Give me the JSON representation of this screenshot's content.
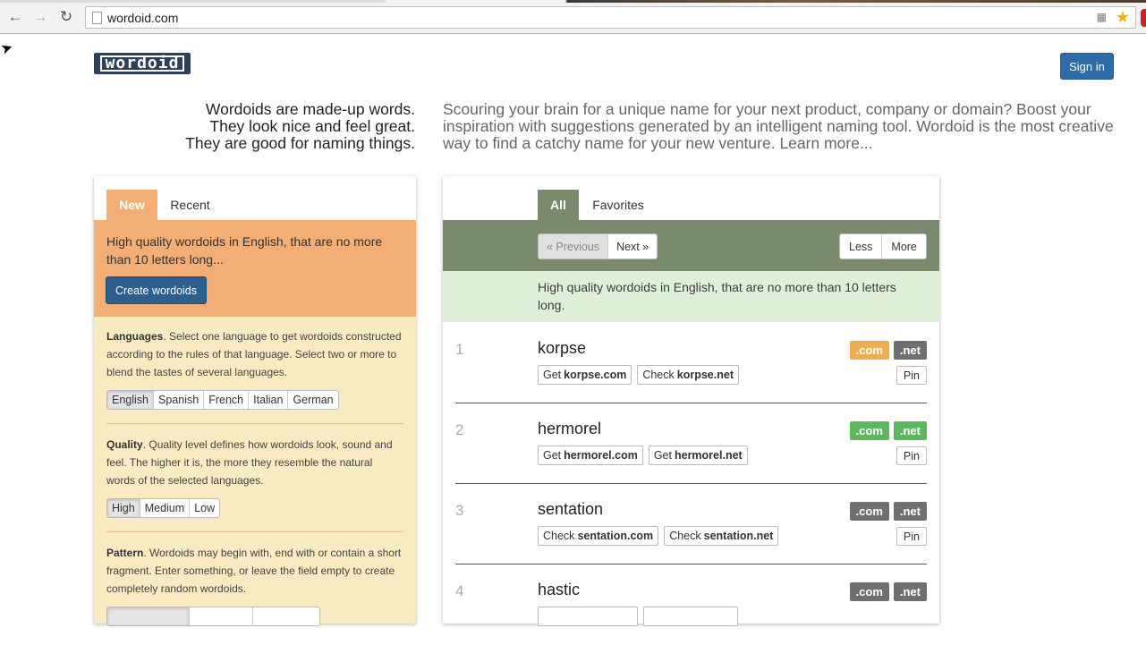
{
  "browser": {
    "url": "wordoid.com",
    "icons": [
      "back-icon",
      "forward-icon",
      "reload-icon",
      "page-icon",
      "translate-icon",
      "star-icon"
    ]
  },
  "header": {
    "logo_text": "wordoid",
    "signin_label": "Sign in"
  },
  "tagline": {
    "line1": "Wordoids are made-up words.",
    "line2": "They look nice and feel great.",
    "line3": "They are good for naming things."
  },
  "intro": {
    "text": "Scouring your brain for a unique name for your next product, company or domain? Boost your inspiration with suggestions generated by an intelligent naming tool. Wordoid is the most creative way to find a catchy name for your new venture.",
    "learn_more": "Learn more..."
  },
  "left": {
    "tabs": [
      {
        "label": "New",
        "active": true
      },
      {
        "label": "Recent",
        "active": false
      }
    ],
    "description": "High quality wordoids in English, that are no more than 10 letters long...",
    "create_label": "Create wordoids",
    "languages": {
      "title": "Languages",
      "text": ". Select one language to get wordoids constructed according to the rules of that language. Select two or more to blend the tastes of several languages.",
      "options": [
        {
          "label": "English",
          "active": true
        },
        {
          "label": "Spanish",
          "active": false
        },
        {
          "label": "French",
          "active": false
        },
        {
          "label": "Italian",
          "active": false
        },
        {
          "label": "German",
          "active": false
        }
      ]
    },
    "quality": {
      "title": "Quality",
      "text": ". Quality level defines how wordoids look, sound and feel. The higher it is, the more they resemble the natural words of the selected languages.",
      "options": [
        {
          "label": "High",
          "active": true
        },
        {
          "label": "Medium",
          "active": false
        },
        {
          "label": "Low",
          "active": false
        }
      ]
    },
    "pattern": {
      "title": "Pattern",
      "text": ". Wordoids may begin with, end with or contain a short fragment. Enter something, or leave the field empty to create completely random wordoids."
    }
  },
  "right": {
    "tabs": [
      {
        "label": "All",
        "active": true
      },
      {
        "label": "Favorites",
        "active": false
      }
    ],
    "pager": {
      "prev": "« Previous",
      "next": "Next »"
    },
    "size": {
      "less": "Less",
      "more": "More"
    },
    "info": "High quality wordoids in English, that are no more than 10 letters long.",
    "pin_label": "Pin",
    "results": [
      {
        "num": "1",
        "word": "korpse",
        "links": [
          {
            "prefix": "Get",
            "domain": "korpse.com"
          },
          {
            "prefix": "Check",
            "domain": "korpse.net"
          }
        ],
        "com": {
          "label": ".com",
          "status": "orange"
        },
        "net": {
          "label": ".net",
          "status": "gray"
        }
      },
      {
        "num": "2",
        "word": "hermorel",
        "links": [
          {
            "prefix": "Get",
            "domain": "hermorel.com"
          },
          {
            "prefix": "Get",
            "domain": "hermorel.net"
          }
        ],
        "com": {
          "label": ".com",
          "status": "green"
        },
        "net": {
          "label": ".net",
          "status": "green"
        }
      },
      {
        "num": "3",
        "word": "sentation",
        "links": [
          {
            "prefix": "Check",
            "domain": "sentation.com"
          },
          {
            "prefix": "Check",
            "domain": "sentation.net"
          }
        ],
        "com": {
          "label": ".com",
          "status": "gray"
        },
        "net": {
          "label": ".net",
          "status": "gray"
        }
      },
      {
        "num": "4",
        "word": "hastic",
        "links": [],
        "com": {
          "label": ".com",
          "status": "gray"
        },
        "net": {
          "label": ".net",
          "status": "gray"
        }
      }
    ]
  },
  "colors": {
    "orange_panel": "#f3ae76",
    "settings_bg": "#f8ebc2",
    "green_bar": "#7a8a6c",
    "info_bg": "#dff0d8",
    "primary": "#2d6ca8"
  }
}
